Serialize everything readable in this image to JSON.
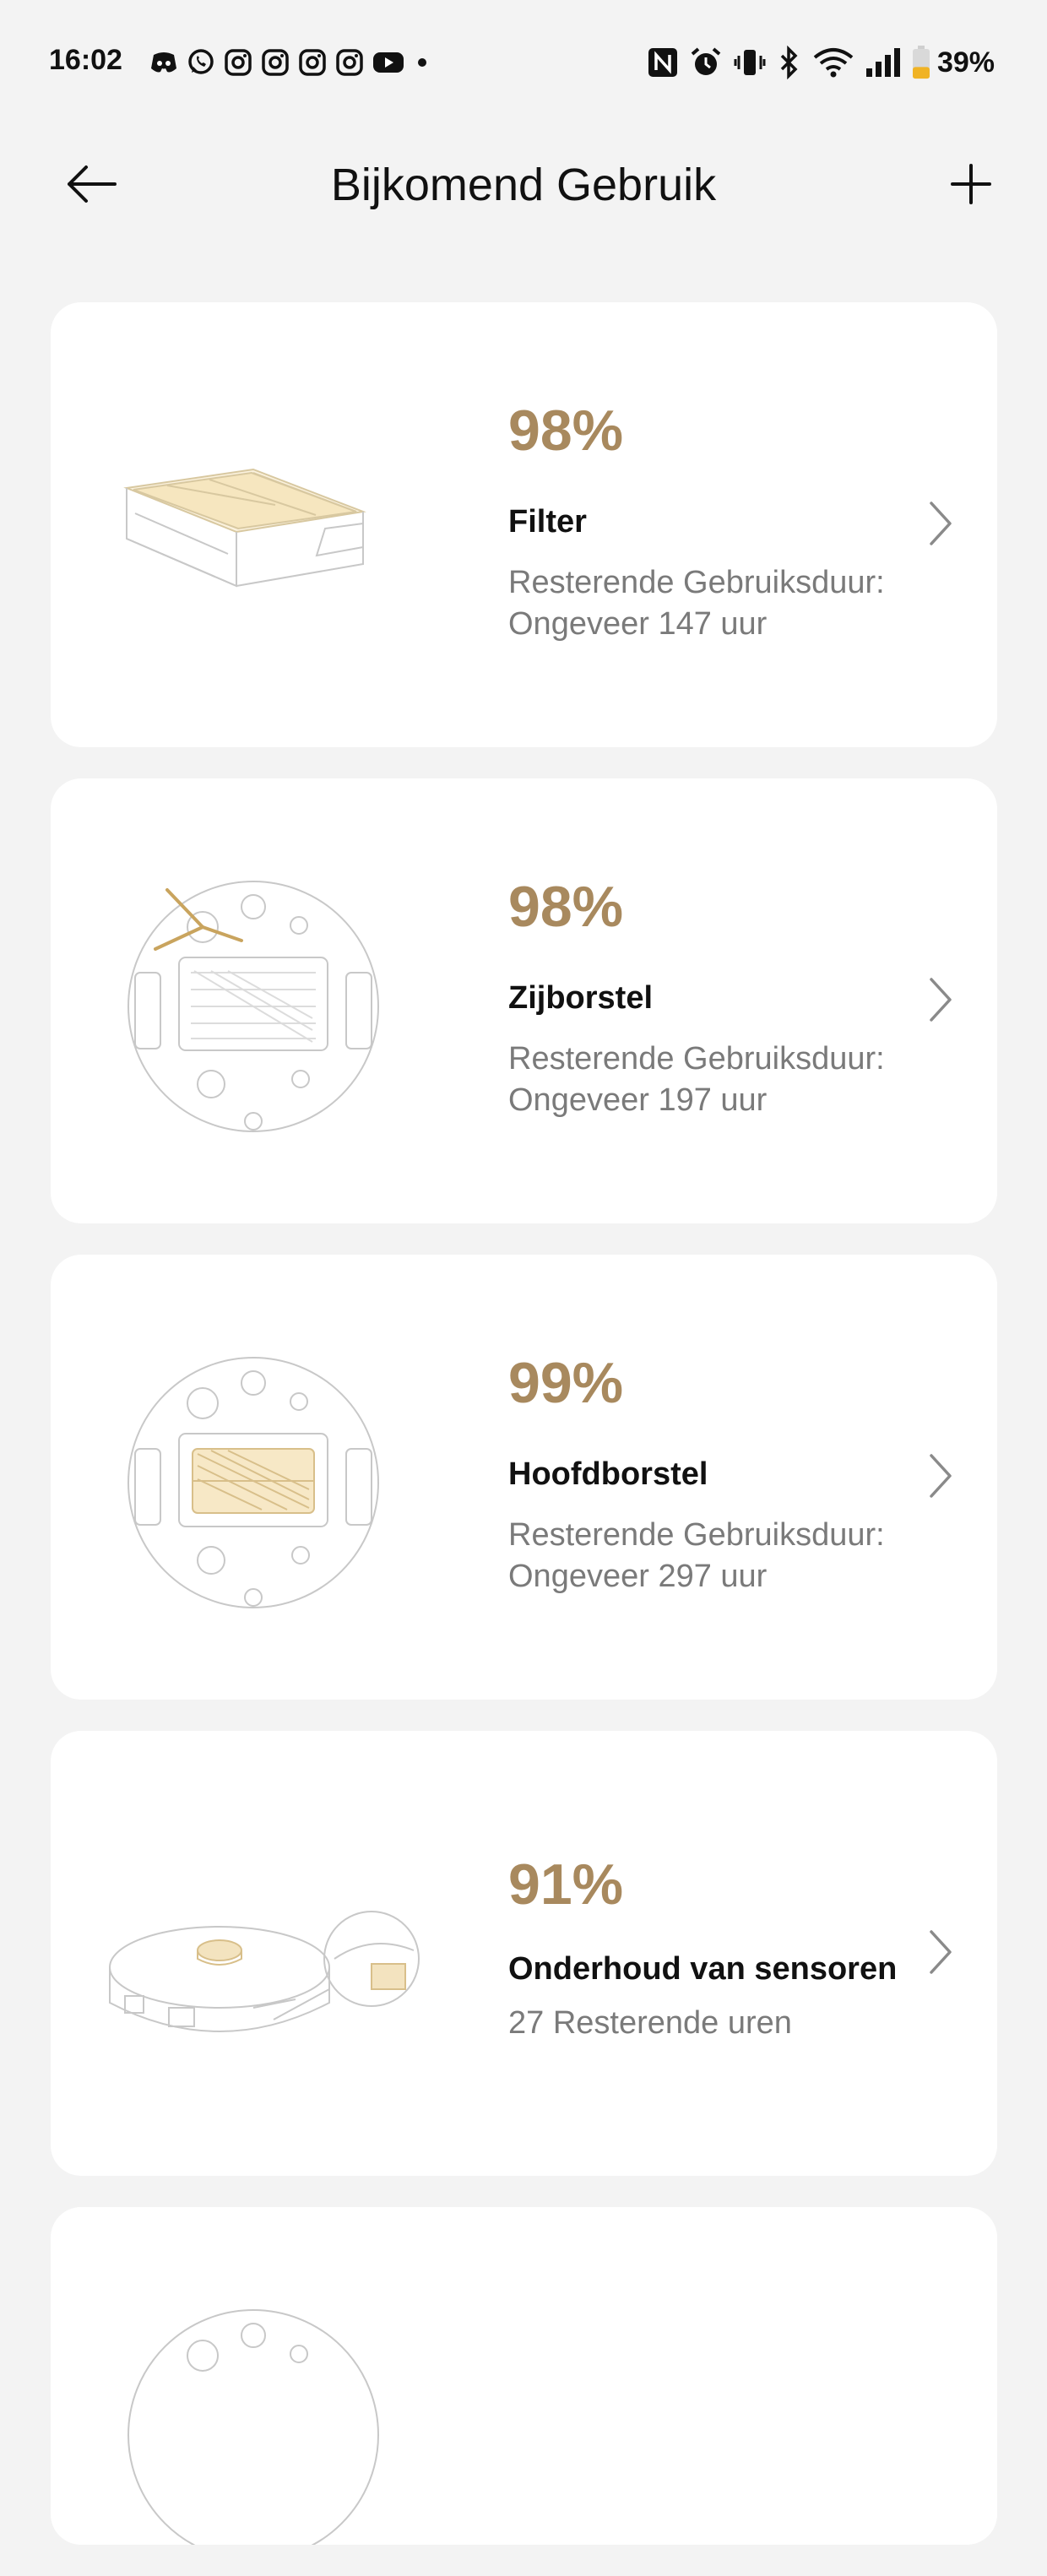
{
  "status_bar": {
    "time": "16:02",
    "notification_icons": [
      "discord-icon",
      "whatsapp-icon",
      "instagram-icon",
      "instagram-icon",
      "instagram-icon",
      "instagram-icon",
      "youtube-icon",
      "dot-icon"
    ],
    "system_icons": [
      "nfc-icon",
      "alarm-icon",
      "vibrate-icon",
      "bluetooth-icon",
      "wifi-icon",
      "signal-icon",
      "battery-icon"
    ],
    "battery_percent": "39%",
    "battery_level": 0.39
  },
  "header": {
    "title": "Bijkomend Gebruik",
    "back_icon": "arrow-left-icon",
    "add_icon": "plus-icon"
  },
  "colors": {
    "accent": "#a8895e",
    "background": "#f3f3f3",
    "card": "#ffffff",
    "secondary_text": "#7a7a7a",
    "battery_fill": "#f0b324"
  },
  "parts": [
    {
      "percent": "98%",
      "name": "Filter",
      "desc_line1": "Resterende Gebruiksduur:",
      "desc_line2": "Ongeveer 147 uur",
      "illustration": "filter-illustration"
    },
    {
      "percent": "98%",
      "name": "Zijborstel",
      "desc_line1": "Resterende Gebruiksduur:",
      "desc_line2": "Ongeveer 197 uur",
      "illustration": "side-brush-illustration"
    },
    {
      "percent": "99%",
      "name": "Hoofdborstel",
      "desc_line1": "Resterende Gebruiksduur:",
      "desc_line2": "Ongeveer 297 uur",
      "illustration": "main-brush-illustration"
    },
    {
      "percent": "91%",
      "name": "Onderhoud van sensoren",
      "desc_line1": "27 Resterende uren",
      "illustration": "sensor-illustration"
    }
  ]
}
